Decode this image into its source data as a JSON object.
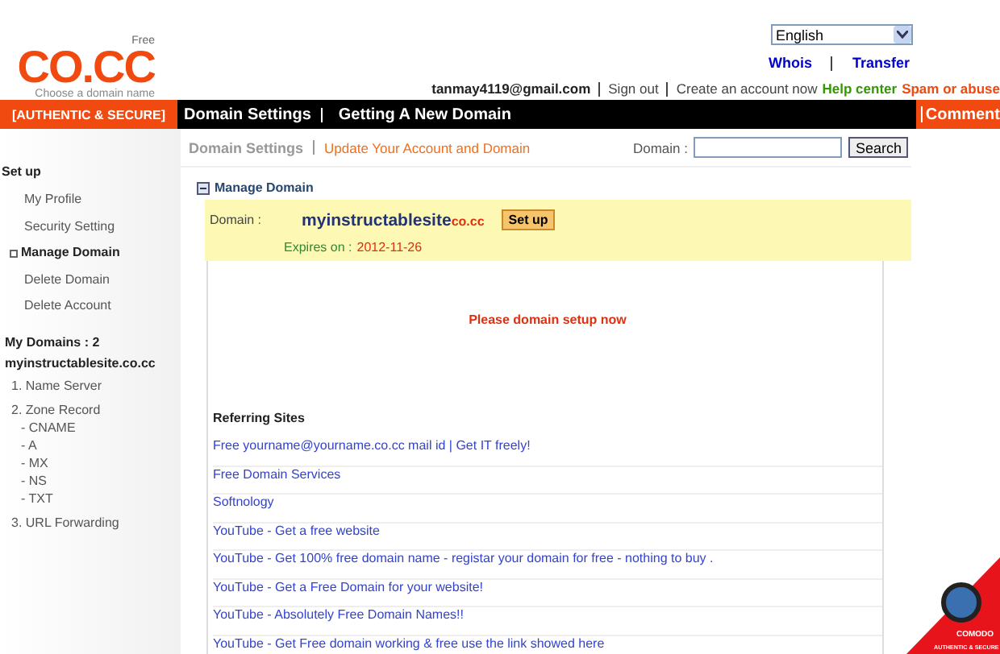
{
  "logo": {
    "tag": "Free",
    "name": "CO.CC",
    "slogan": "Choose a domain name"
  },
  "language": {
    "value": "English"
  },
  "top_links": [
    "Whois",
    "Transfer"
  ],
  "account": {
    "email": "tanmay4119@gmail.com",
    "links": [
      {
        "label": "Sign out",
        "kind": "plain"
      },
      {
        "label": "Create an account now",
        "kind": "plain"
      },
      {
        "label": "Help center",
        "kind": "help"
      },
      {
        "label": "Spam or abuse",
        "kind": "alert"
      }
    ]
  },
  "nav": {
    "badge": "[AUTHENTIC & SECURE]",
    "items": [
      "Domain Settings",
      "Getting A New Domain"
    ],
    "comment": "Comment"
  },
  "sidebar": {
    "heading": "Set up",
    "items": [
      {
        "label": "My Profile",
        "selected": false
      },
      {
        "label": "Security Setting",
        "selected": false
      },
      {
        "label": "Manage Domain",
        "selected": true
      },
      {
        "label": "Delete Domain",
        "selected": false
      },
      {
        "label": "Delete Account",
        "selected": false
      }
    ],
    "domains_title": "My Domains : 2",
    "domain": "myinstructablesite.co.cc",
    "tree": [
      {
        "label": "1. Name Server"
      },
      {
        "label": "2. Zone Record",
        "children": [
          {
            "label": "- CNAME"
          },
          {
            "label": "- A"
          },
          {
            "label": "- MX"
          },
          {
            "label": "- NS"
          },
          {
            "label": "- TXT"
          }
        ]
      },
      {
        "label": "3. URL Forwarding"
      }
    ]
  },
  "content": {
    "title": "Domain Settings",
    "subtitle": "Update Your Account and Domain",
    "search_label": "Domain :",
    "search_button": "Search",
    "section": "Manage Domain",
    "domain_label": "Domain :",
    "domain_name": "myinstructablesite",
    "domain_suffix": "co.cc",
    "setup_button": "Set up",
    "expires_label": "Expires on :",
    "expires": "2012-11-26",
    "notice": "Please domain setup now",
    "referring_title": "Referring Sites",
    "referring": [
      "Free yourname@yourname.co.cc mail id | Get IT freely!",
      "Free Domain Services",
      "Softnology",
      "YouTube - Get a free website",
      "YouTube - Get 100% free domain name - registar your domain for free - nothing to buy .",
      "YouTube - Get a Free Domain for your website!",
      "YouTube - Absolutely Free Domain Names!!",
      "YouTube - Get Free domain working & free use the link showed here"
    ]
  },
  "seal": {
    "brand": "COMODO",
    "text": "AUTHENTIC & SECURE"
  }
}
